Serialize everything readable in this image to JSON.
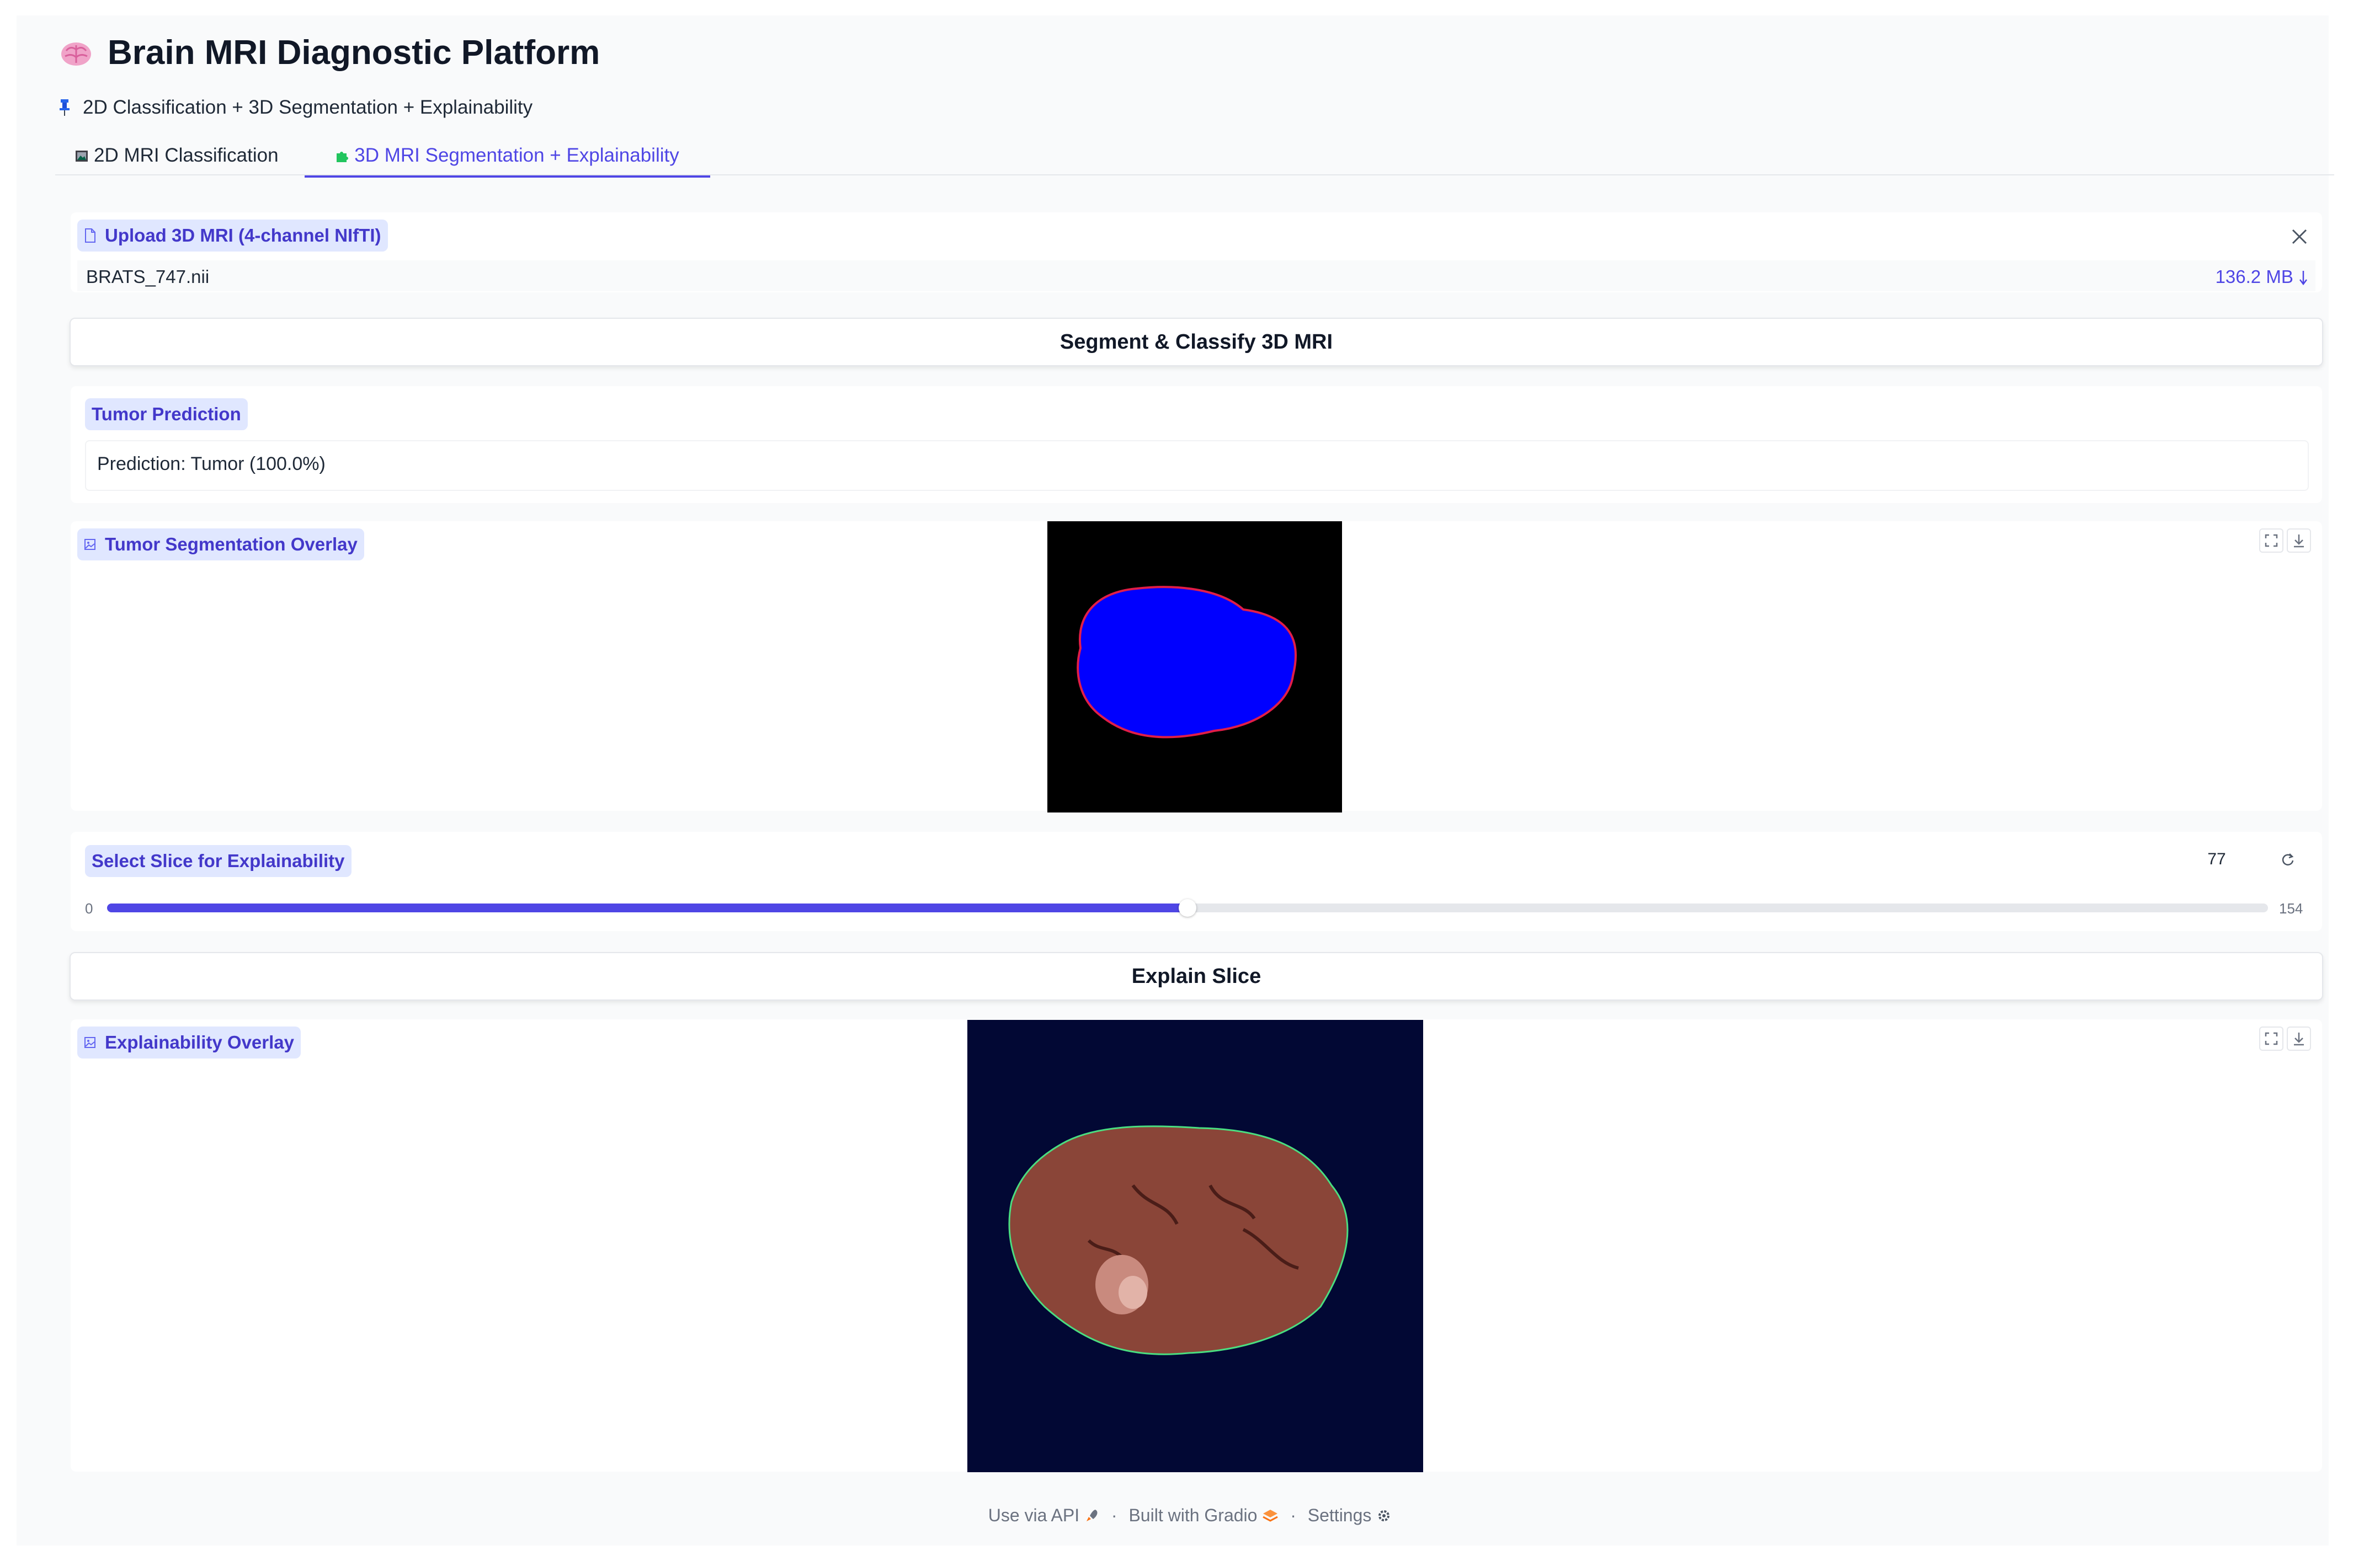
{
  "app": {
    "title": "Brain MRI Diagnostic Platform",
    "subtitle": "2D Classification + 3D Segmentation + Explainability",
    "title_icon": "brain-icon",
    "subtitle_icon": "pushpin-icon"
  },
  "tabs": [
    {
      "label": "2D MRI Classification",
      "icon": "framed-picture-icon",
      "active": false
    },
    {
      "label": "3D MRI Segmentation + Explainability",
      "icon": "puzzle-icon",
      "active": true
    }
  ],
  "upload": {
    "label": "Upload 3D MRI (4-channel NIfTI)",
    "file_name": "BRATS_747.nii",
    "file_size": "136.2 MB",
    "close_icon": "close-icon",
    "download_icon": "download-arrow-icon"
  },
  "segment_button": {
    "label": "Segment & Classify 3D MRI"
  },
  "prediction": {
    "label": "Tumor Prediction",
    "text": "Prediction: Tumor (100.0%)"
  },
  "segmentation": {
    "label": "Tumor Segmentation Overlay",
    "icon": "image-icon"
  },
  "slider": {
    "label": "Select Slice for Explainability",
    "value": 77,
    "min": 0,
    "max": 154,
    "reset_icon": "reset-icon"
  },
  "explain_button": {
    "label": "Explain Slice"
  },
  "explainability": {
    "label": "Explainability Overlay",
    "icon": "image-icon"
  },
  "footer": {
    "api": "Use via API",
    "api_icon": "rocket-icon",
    "built": "Built with Gradio",
    "built_icon": "gradio-logo-icon",
    "settings": "Settings",
    "settings_icon": "gear-icon",
    "separator": "·"
  },
  "colors": {
    "accent": "#4f46e5",
    "pill_bg": "#e0e7ff",
    "segmentation_fill": "#0000ff",
    "segmentation_edge": "#e11d48",
    "explain_bg": "#020834",
    "explain_brain": "#8a4538"
  }
}
